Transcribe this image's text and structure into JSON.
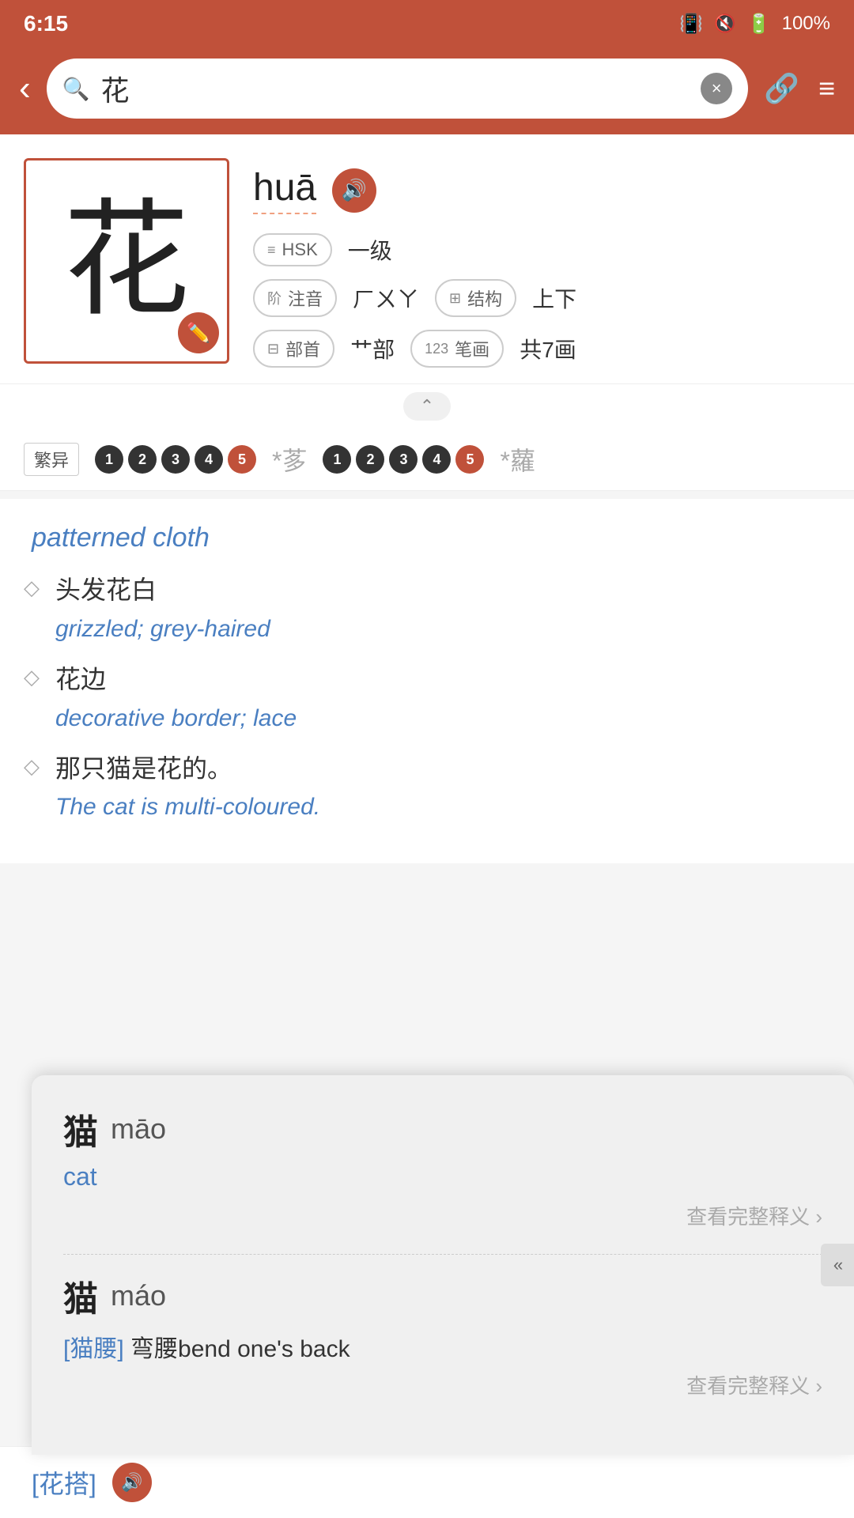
{
  "statusBar": {
    "time": "6:15",
    "battery": "100%"
  },
  "topBar": {
    "searchValue": "花",
    "backLabel": "‹",
    "clearLabel": "×"
  },
  "character": {
    "hanzi": "花",
    "pinyin": "huā",
    "hskLevel": "一级",
    "hskLabel": "HSK",
    "pronunciation": "ㄏㄨㄚ",
    "structure": "上下",
    "radical": "艹部",
    "strokes": "共7画",
    "pronounceLabel": "注音",
    "structureLabel": "结构",
    "radicalLabel": "部首",
    "strokesLabel": "笔画"
  },
  "variantRow": {
    "label": "繁异",
    "tones": [
      "1",
      "2",
      "3",
      "4",
      "5"
    ],
    "activeIndex": 4,
    "charCang": "茤",
    "charLuo": "蘿",
    "charCangNote": "*茤",
    "charLuoNote": "*蘿"
  },
  "definitions": [
    {
      "english": "patterned cloth",
      "examples": []
    },
    {
      "english": "grizzled; grey-haired",
      "examples": [
        {
          "chinese": "头发花白",
          "english": "grizzled; grey-haired"
        }
      ]
    },
    {
      "english": "decorative border; lace",
      "examples": [
        {
          "chinese": "花边",
          "english": "decorative border; lace"
        }
      ]
    },
    {
      "english": "The cat is multi-coloured.",
      "examples": [
        {
          "chinese": "那只猫是花的。",
          "english": "The cat is multi-coloured."
        }
      ]
    }
  ],
  "popup": {
    "entries": [
      {
        "char": "猫",
        "pinyin": "māo",
        "definition": "cat",
        "linkText": "查看完整释义 ›"
      },
      {
        "char": "猫",
        "pinyin": "máo",
        "exampleBracket": "[猫腰]",
        "exampleRest": " 弯腰bend one's back",
        "linkText": "查看完整释义 ›"
      }
    ],
    "closeLabel": "«"
  },
  "bottomFloat": {
    "text": "[花搭]"
  }
}
